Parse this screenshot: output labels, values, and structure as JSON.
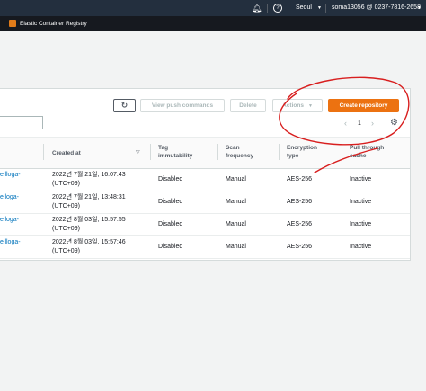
{
  "nav": {
    "region": "Seoul",
    "account": "soma13056 @ 0237-7816-2658"
  },
  "service": {
    "name": "Elastic Container Registry"
  },
  "toolbar": {
    "view_push": "View push commands",
    "delete": "Delete",
    "actions": "Actions",
    "create": "Create repository"
  },
  "pagination": {
    "page": "1"
  },
  "table": {
    "headers": {
      "created_at": "Created at",
      "tag_immutability": [
        "Tag",
        "immutability"
      ],
      "scan_frequency": [
        "Scan",
        "frequency"
      ],
      "encryption_type": [
        "Encryption",
        "type"
      ],
      "pull_through_cache": [
        "Pull through",
        "cache"
      ]
    },
    "rows": [
      {
        "name": "ellloga-",
        "created": [
          "2022년 7월 21일, 16:07:43",
          "(UTC+09)"
        ],
        "tag": "Disabled",
        "scan": "Manual",
        "enc": "AES-256",
        "cache": "Inactive"
      },
      {
        "name": "elloga-",
        "created": [
          "2022년 7월 21일, 13:48:31",
          "(UTC+09)"
        ],
        "tag": "Disabled",
        "scan": "Manual",
        "enc": "AES-256",
        "cache": "Inactive"
      },
      {
        "name": "elloga-",
        "created": [
          "2022년 8월 03일, 15:57:55",
          "(UTC+09)"
        ],
        "tag": "Disabled",
        "scan": "Manual",
        "enc": "AES-256",
        "cache": "Inactive"
      },
      {
        "name": "ellloga-",
        "created": [
          "2022년 8월 03일, 15:57:46",
          "(UTC+09)"
        ],
        "tag": "Disabled",
        "scan": "Manual",
        "enc": "AES-256",
        "cache": "Inactive"
      }
    ]
  },
  "annotation_color": "#d81e1e",
  "brand_color": "#ec7211"
}
